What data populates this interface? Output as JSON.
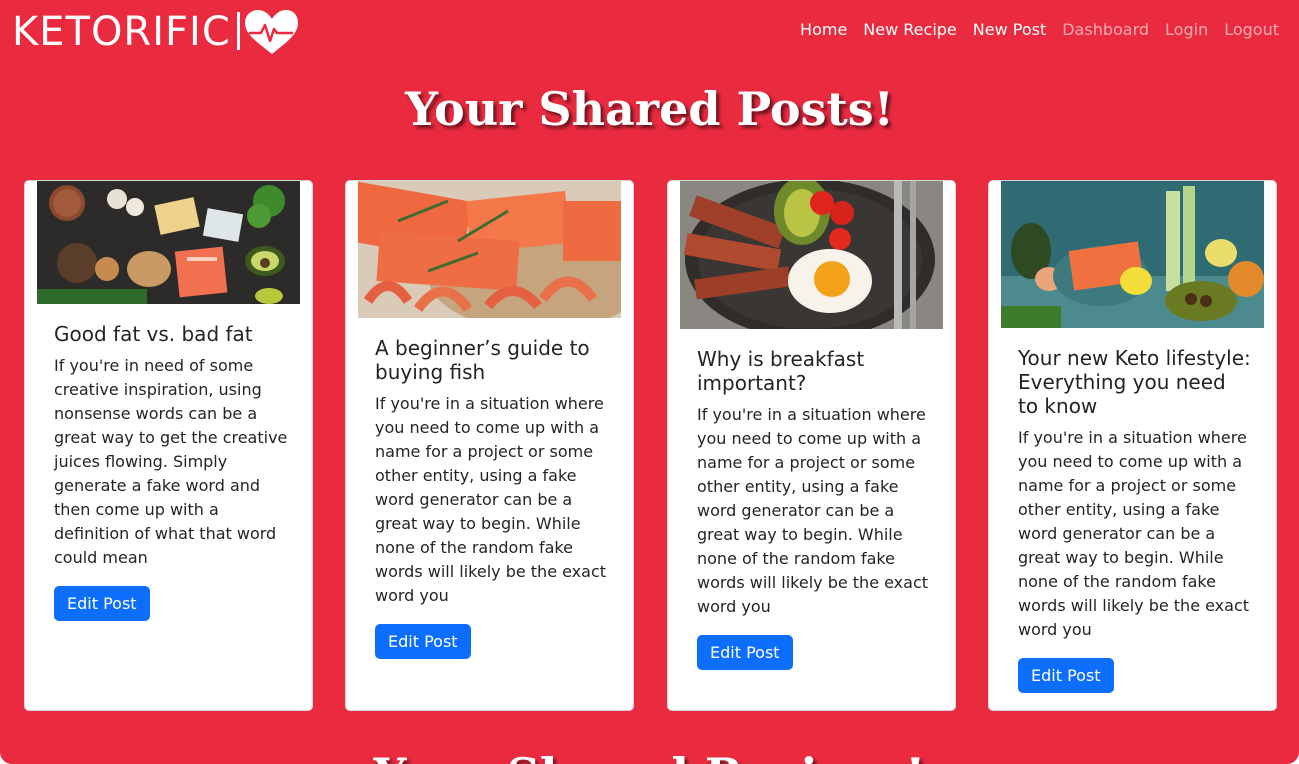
{
  "brand": {
    "name": "KETORIFIC"
  },
  "nav": {
    "items": [
      {
        "label": "Home"
      },
      {
        "label": "New Recipe"
      },
      {
        "label": "New Post"
      },
      {
        "label": "Dashboard"
      },
      {
        "label": "Login"
      },
      {
        "label": "Logout"
      }
    ]
  },
  "page": {
    "title": "Your Shared Posts!",
    "next_section_title": "Your Shared Recipes!"
  },
  "posts": [
    {
      "title": "Good fat vs. bad fat",
      "body": "If you're in need of some creative inspiration, using nonsense words can be a great way to get the creative juices flowing. Simply generate a fake word and then come up with a definition of what that word could mean",
      "button": "Edit Post",
      "image": "keto-foods-photo"
    },
    {
      "title": "A beginner’s guide to buying fish",
      "body": "If you're in a situation where you need to come up with a name for a project or some other entity, using a fake word generator can be a great way to begin. While none of the random fake words will likely be the exact word you",
      "button": "Edit Post",
      "image": "salmon-shrimp-photo"
    },
    {
      "title": "Why is breakfast important?",
      "body": "If you're in a situation where you need to come up with a name for a project or some other entity, using a fake word generator can be a great way to begin. While none of the random fake words will likely be the exact word you",
      "button": "Edit Post",
      "image": "bacon-eggs-avocado-photo"
    },
    {
      "title": "Your new Keto lifestyle: Everything you need to know",
      "body": "If you're in a situation where you need to come up with a name for a project or some other entity, using a fake word generator can be a great way to begin. While none of the random fake words will likely be the exact word you",
      "button": "Edit Post",
      "image": "salmon-vegetables-photo"
    }
  ],
  "colors": {
    "background": "#e92a3f",
    "button": "#0d6efd",
    "card": "#ffffff"
  }
}
